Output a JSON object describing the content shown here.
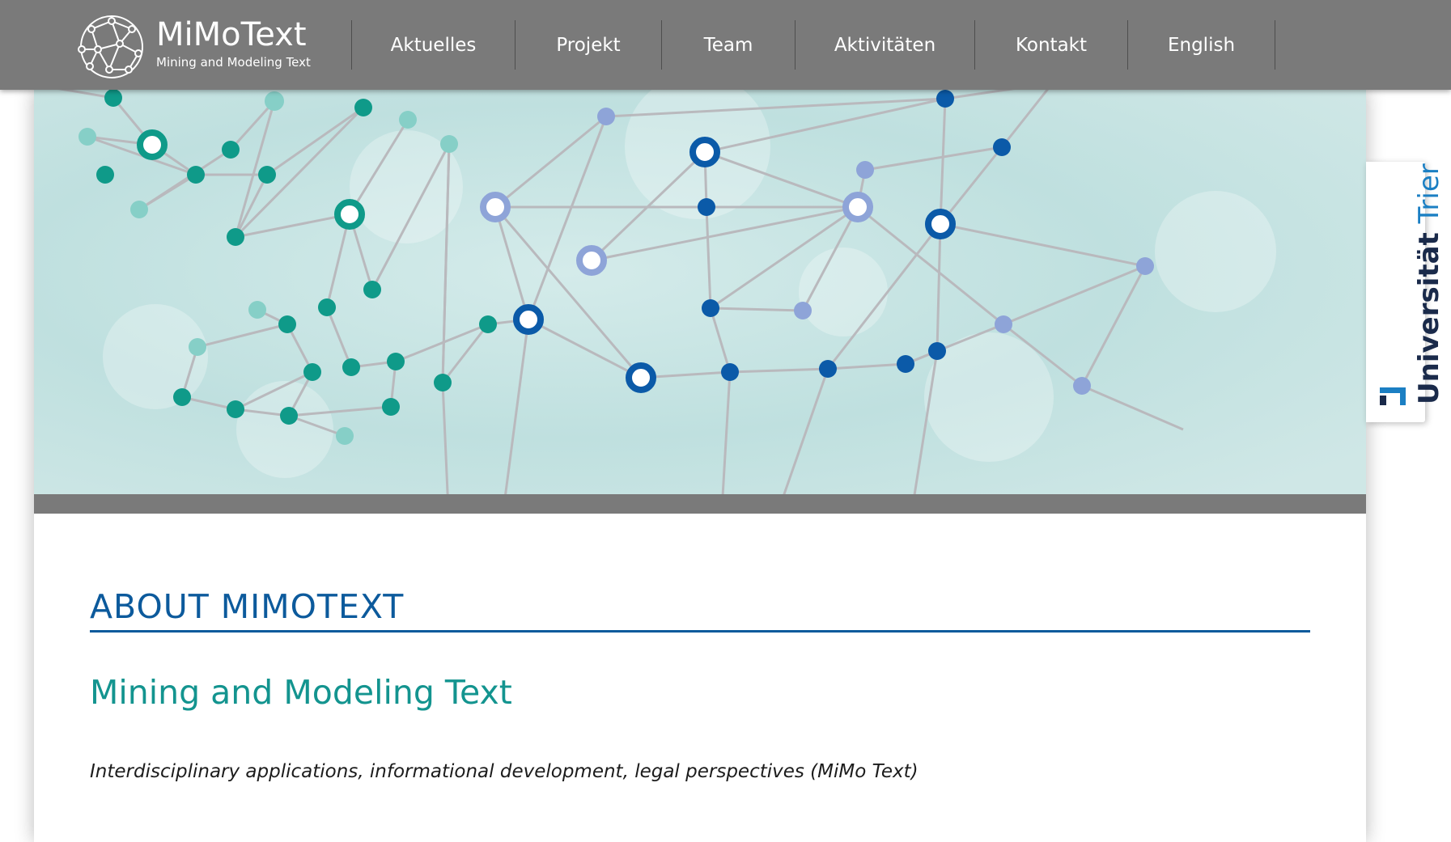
{
  "header": {
    "logo_title": "MiMoText",
    "logo_subtitle": "Mining and Modeling Text",
    "nav": [
      {
        "label": "Aktuelles"
      },
      {
        "label": "Projekt"
      },
      {
        "label": "Team"
      },
      {
        "label": "Aktivitäten"
      },
      {
        "label": "Kontakt"
      },
      {
        "label": "English"
      }
    ]
  },
  "content": {
    "section_title": "ABOUT MIMOTEXT",
    "subtitle": "Mining and Modeling Text",
    "tagline": "Interdisciplinary applications, informational development, legal perspectives (MiMo Text)"
  },
  "side_tab": {
    "word1": "Universität",
    "word2": "Trier"
  },
  "colors": {
    "header_bg": "#7a7a7a",
    "title_blue": "#0c5a9c",
    "subtitle_teal": "#13948f",
    "node_teal": "#0f9a89",
    "node_blue": "#0b5aa8",
    "node_lavender": "#8ea4d8"
  },
  "icons": {
    "logo": "network-logo-icon",
    "university": "university-trier-logo-icon"
  }
}
